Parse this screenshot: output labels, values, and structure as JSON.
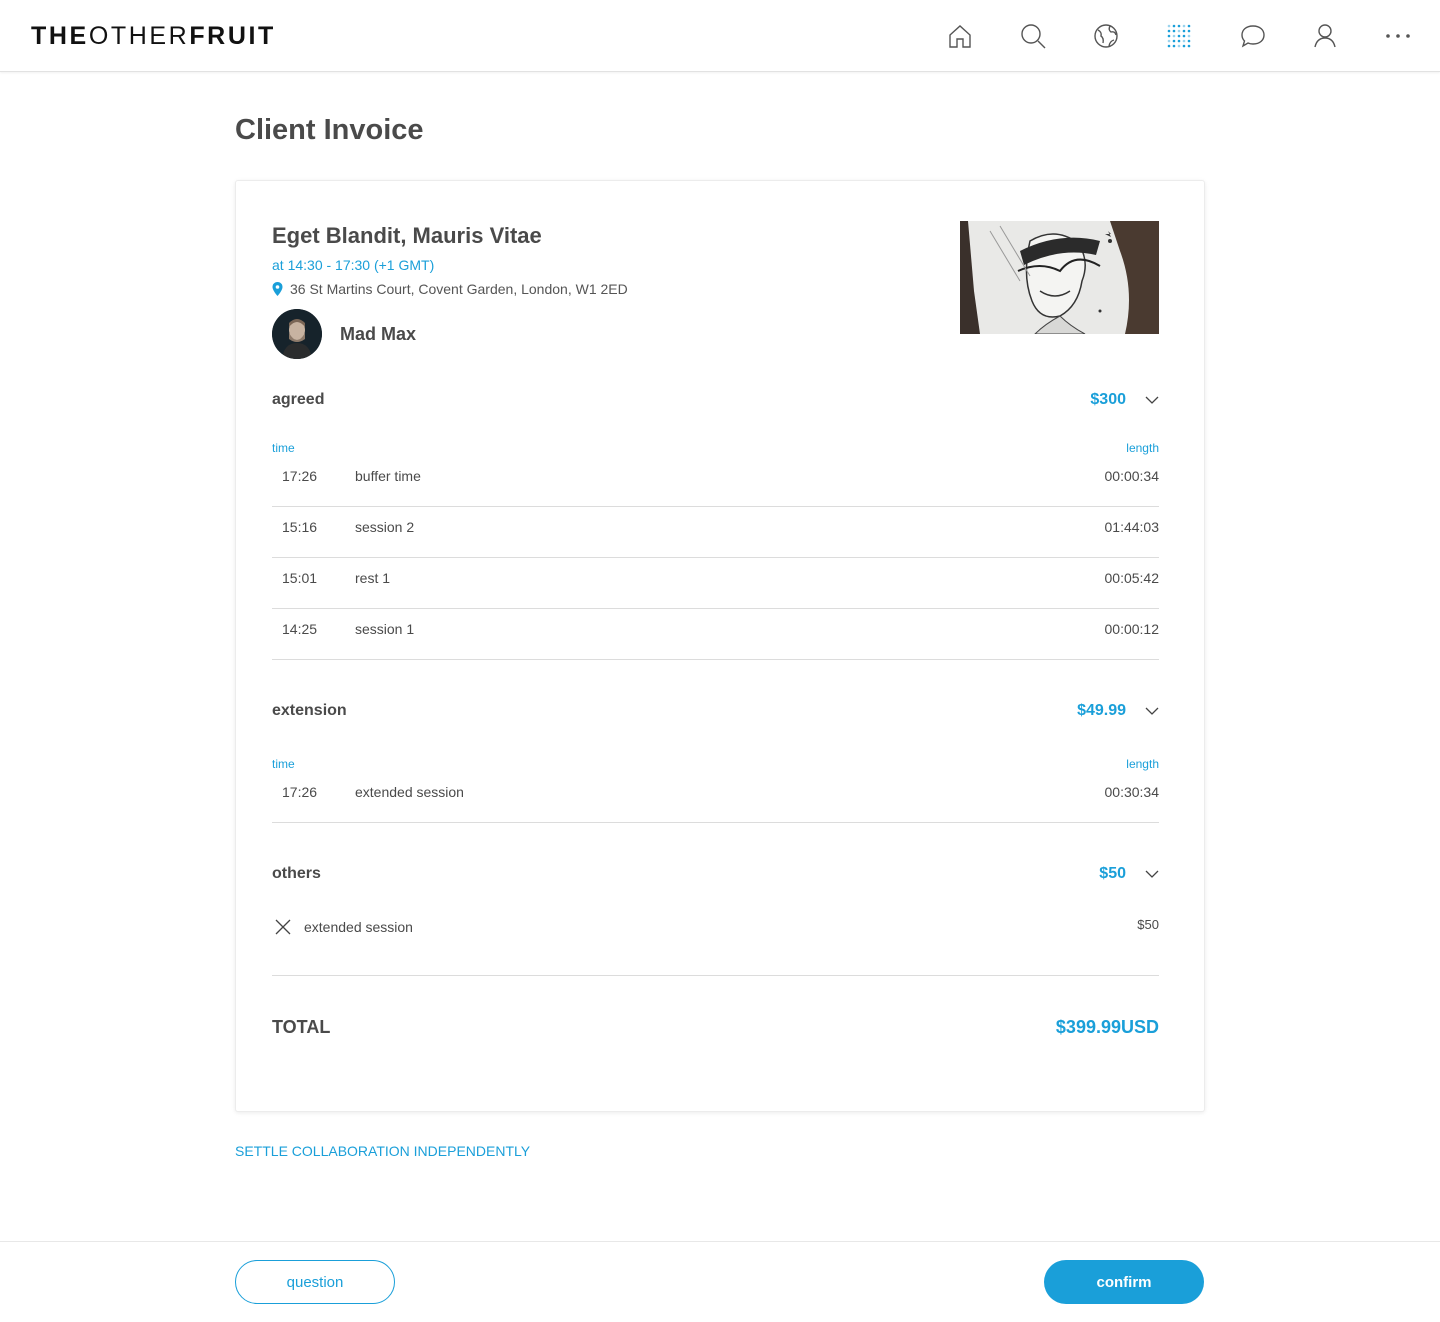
{
  "header": {
    "logo_bold1": "THE",
    "logo_light": "OTHER",
    "logo_bold2": "FRUIT",
    "nav_icons": [
      "home-icon",
      "search-icon",
      "globe-icon",
      "dots-grid-icon",
      "chat-icon",
      "user-icon",
      "more-icon"
    ]
  },
  "page": {
    "title": "Client Invoice"
  },
  "invoice": {
    "session_title": "Eget Blandit, Mauris Vitae",
    "time": "at 14:30 - 17:30 (+1 GMT)",
    "address": "36 St Martins Court, Covent Garden, London, W1 2ED",
    "artist_name": "Mad Max",
    "agreed": {
      "label": "agreed",
      "amount": "$300",
      "col_time": "time",
      "col_length": "length",
      "rows": [
        {
          "time": "17:26",
          "desc": "buffer time",
          "length": "00:00:34"
        },
        {
          "time": "15:16",
          "desc": "session 2",
          "length": "01:44:03"
        },
        {
          "time": "15:01",
          "desc": "rest 1",
          "length": "00:05:42"
        },
        {
          "time": "14:25",
          "desc": "session 1",
          "length": "00:00:12"
        }
      ]
    },
    "extension": {
      "label": "extension",
      "amount": "$49.99",
      "col_time": "time",
      "col_length": "length",
      "rows": [
        {
          "time": "17:26",
          "desc": "extended session",
          "length": "00:30:34"
        }
      ]
    },
    "others": {
      "label": "others",
      "amount": "$50",
      "items": [
        {
          "desc": "extended session",
          "amount": "$50"
        }
      ]
    },
    "total_label": "TOTAL",
    "total_amount": "$399.99USD"
  },
  "settle_link": "SETTLE COLLABORATION INDEPENDENTLY",
  "footer": {
    "question_label": "question",
    "confirm_label": "confirm"
  },
  "colors": {
    "accent": "#1a9fd9",
    "text": "#4a4a4a"
  }
}
